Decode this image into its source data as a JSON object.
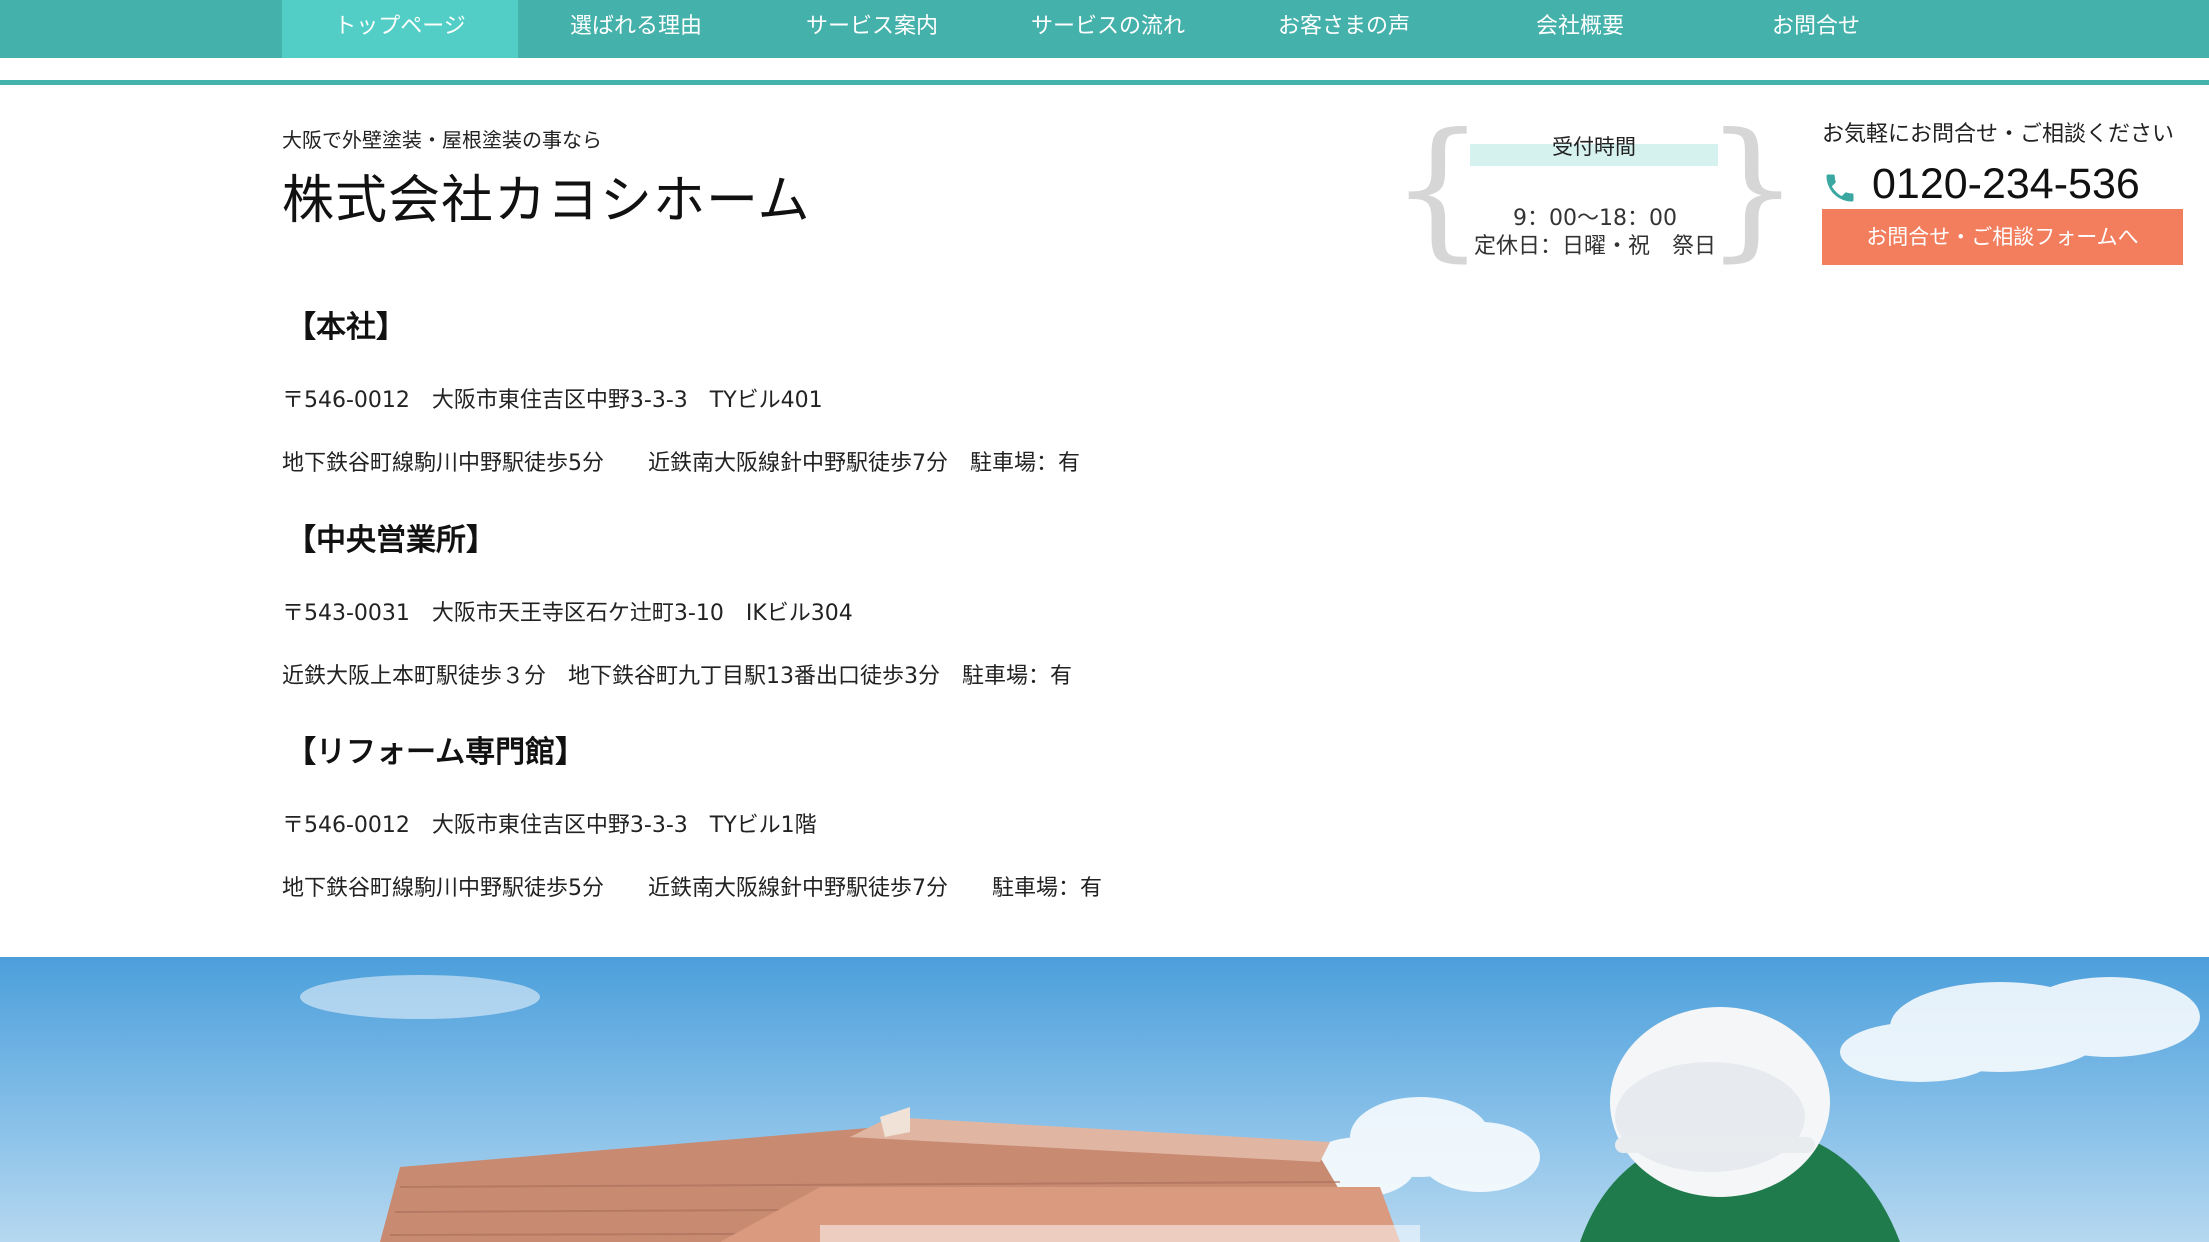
{
  "nav": {
    "items": [
      {
        "label": "トップページ",
        "active": true
      },
      {
        "label": "選ばれる理由"
      },
      {
        "label": "サービス案内"
      },
      {
        "label": "サービスの流れ"
      },
      {
        "label": "お客さまの声"
      },
      {
        "label": "会社概要"
      },
      {
        "label": "お問合せ"
      }
    ]
  },
  "header": {
    "tagline": "大阪で外壁塗装・屋根塗装の事なら",
    "company_name": "株式会社カヨシホーム",
    "hours": {
      "title": "受付時間",
      "time": "9：00〜18：00",
      "closed": "定休日：日曜・祝　祭日"
    },
    "contact": {
      "lead": "お気軽にお問合せ・ご相談ください",
      "phone": "0120-234-536",
      "button": "お問合せ・ご相談フォームへ"
    }
  },
  "offices": [
    {
      "name": "【本社】",
      "address": "〒546-0012　大阪市東住吉区中野3-3-3　TYビル401",
      "access": "地下鉄谷町線駒川中野駅徒歩5分　　近鉄南大阪線針中野駅徒歩7分　駐車場：有"
    },
    {
      "name": "【中央営業所】",
      "address": "〒543-0031　大阪市天王寺区石ケ辻町3-10　IKビル304",
      "access": "近鉄大阪上本町駅徒歩３分　地下鉄谷町九丁目駅13番出口徒歩3分　駐車場：有"
    },
    {
      "name": "【リフォーム専門館】",
      "address": "〒546-0012　大阪市東住吉区中野3-3-3　TYビル1階",
      "access": "地下鉄谷町線駒川中野駅徒歩5分　　近鉄南大阪線針中野駅徒歩7分　　駐車場：有"
    }
  ],
  "colors": {
    "nav": "#45b1ab",
    "nav_active": "#52cec6",
    "accent_button": "#f27e5e",
    "phone_icon": "#3aa7a0"
  }
}
